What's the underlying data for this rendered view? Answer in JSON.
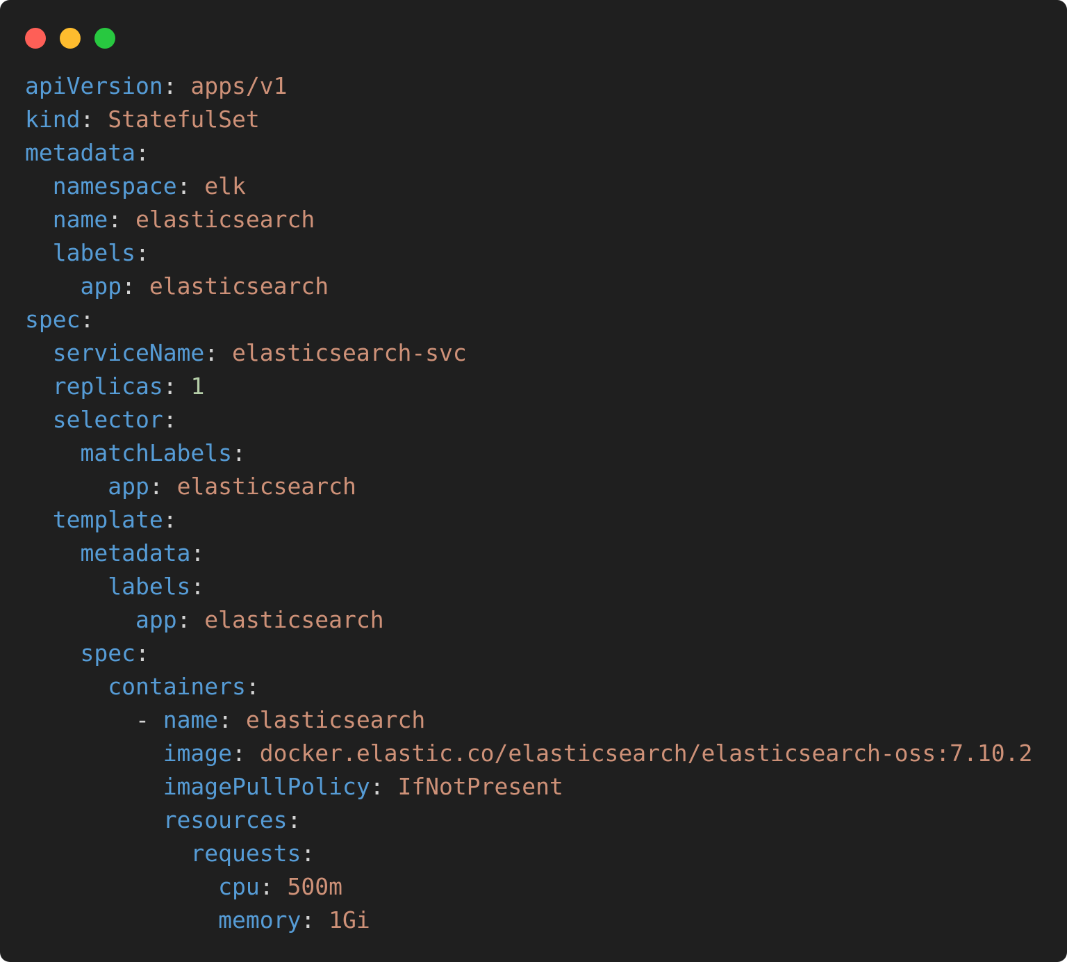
{
  "window": {
    "controls": [
      {
        "name": "close",
        "color": "#fe5f57"
      },
      {
        "name": "minimize",
        "color": "#febc2e"
      },
      {
        "name": "zoom",
        "color": "#28c840"
      }
    ]
  },
  "theme": {
    "background": "#1f1f1f",
    "key_color": "#569cd6",
    "string_color": "#ce9178",
    "number_color": "#b5cea8",
    "punctuation_color": "#d4d4d4"
  },
  "code": {
    "language": "yaml",
    "lines": [
      {
        "indent": "",
        "dash": "",
        "key": "apiVersion",
        "sep": ":",
        "value": " apps/v1",
        "vtype": "str"
      },
      {
        "indent": "",
        "dash": "",
        "key": "kind",
        "sep": ":",
        "value": " StatefulSet",
        "vtype": "str"
      },
      {
        "indent": "",
        "dash": "",
        "key": "metadata",
        "sep": ":",
        "value": "",
        "vtype": "str"
      },
      {
        "indent": "  ",
        "dash": "",
        "key": "namespace",
        "sep": ":",
        "value": " elk",
        "vtype": "str"
      },
      {
        "indent": "  ",
        "dash": "",
        "key": "name",
        "sep": ":",
        "value": " elasticsearch",
        "vtype": "str"
      },
      {
        "indent": "  ",
        "dash": "",
        "key": "labels",
        "sep": ":",
        "value": "",
        "vtype": "str"
      },
      {
        "indent": "    ",
        "dash": "",
        "key": "app",
        "sep": ":",
        "value": " elasticsearch",
        "vtype": "str"
      },
      {
        "indent": "",
        "dash": "",
        "key": "spec",
        "sep": ":",
        "value": "",
        "vtype": "str"
      },
      {
        "indent": "  ",
        "dash": "",
        "key": "serviceName",
        "sep": ":",
        "value": " elasticsearch-svc",
        "vtype": "str"
      },
      {
        "indent": "  ",
        "dash": "",
        "key": "replicas",
        "sep": ":",
        "value": " 1",
        "vtype": "num"
      },
      {
        "indent": "  ",
        "dash": "",
        "key": "selector",
        "sep": ":",
        "value": "",
        "vtype": "str"
      },
      {
        "indent": "    ",
        "dash": "",
        "key": "matchLabels",
        "sep": ":",
        "value": "",
        "vtype": "str"
      },
      {
        "indent": "      ",
        "dash": "",
        "key": "app",
        "sep": ":",
        "value": " elasticsearch",
        "vtype": "str"
      },
      {
        "indent": "  ",
        "dash": "",
        "key": "template",
        "sep": ":",
        "value": "",
        "vtype": "str"
      },
      {
        "indent": "    ",
        "dash": "",
        "key": "metadata",
        "sep": ":",
        "value": "",
        "vtype": "str"
      },
      {
        "indent": "      ",
        "dash": "",
        "key": "labels",
        "sep": ":",
        "value": "",
        "vtype": "str"
      },
      {
        "indent": "        ",
        "dash": "",
        "key": "app",
        "sep": ":",
        "value": " elasticsearch",
        "vtype": "str"
      },
      {
        "indent": "    ",
        "dash": "",
        "key": "spec",
        "sep": ":",
        "value": "",
        "vtype": "str"
      },
      {
        "indent": "      ",
        "dash": "",
        "key": "containers",
        "sep": ":",
        "value": "",
        "vtype": "str"
      },
      {
        "indent": "        ",
        "dash": "- ",
        "key": "name",
        "sep": ":",
        "value": " elasticsearch",
        "vtype": "str"
      },
      {
        "indent": "          ",
        "dash": "",
        "key": "image",
        "sep": ":",
        "value": " docker.elastic.co/elasticsearch/elasticsearch-oss:7.10.2",
        "vtype": "str"
      },
      {
        "indent": "          ",
        "dash": "",
        "key": "imagePullPolicy",
        "sep": ":",
        "value": " IfNotPresent",
        "vtype": "str"
      },
      {
        "indent": "          ",
        "dash": "",
        "key": "resources",
        "sep": ":",
        "value": "",
        "vtype": "str"
      },
      {
        "indent": "            ",
        "dash": "",
        "key": "requests",
        "sep": ":",
        "value": "",
        "vtype": "str"
      },
      {
        "indent": "              ",
        "dash": "",
        "key": "cpu",
        "sep": ":",
        "value": " 500m",
        "vtype": "str"
      },
      {
        "indent": "              ",
        "dash": "",
        "key": "memory",
        "sep": ":",
        "value": " 1Gi",
        "vtype": "str"
      }
    ]
  }
}
